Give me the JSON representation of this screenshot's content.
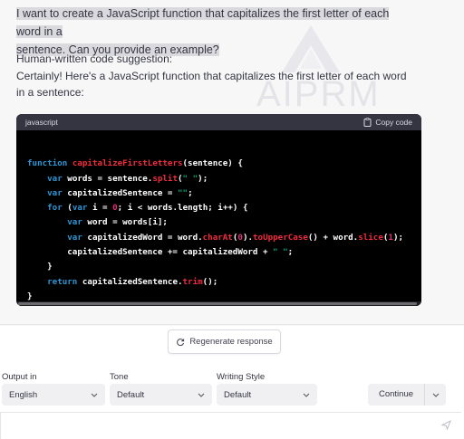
{
  "conversation": {
    "user_line_1": "I want to create a JavaScript function that capitalizes the first letter of each word in a",
    "user_line_2": "sentence. Can you provide an example?",
    "suggestion_label": "Human-written code suggestion:",
    "answer": "Certainly! Here's a JavaScript function that capitalizes the first letter of each word in a sentence:",
    "watermark": "AIPRM"
  },
  "code_block": {
    "language": "javascript",
    "copy_label": "Copy code",
    "lines": [
      "function capitalizeFirstLetters(sentence) {",
      "    var words = sentence.split(\" \");",
      "    var capitalizedSentence = \"\";",
      "    for (var i = 0; i < words.length; i++) {",
      "        var word = words[i];",
      "        var capitalizedWord = word.charAt(0).toUpperCase() + word.slice(1);",
      "        capitalizedSentence += capitalizedWord + \" \";",
      "    }",
      "    return capitalizedSentence.trim();",
      "}"
    ]
  },
  "controls": {
    "regenerate_label": "Regenerate response",
    "output_label": "Output in",
    "output_value": "English",
    "tone_label": "Tone",
    "tone_value": "Default",
    "style_label": "Writing Style",
    "style_value": "Default",
    "continue_label": "Continue",
    "input_placeholder": ""
  },
  "icons": {
    "copy": "clipboard-icon",
    "regenerate": "refresh-icon",
    "dropdown": "chevron-down-icon",
    "send": "paper-plane-icon"
  },
  "colors": {
    "keyword": "#2e95d3",
    "function": "#f22c3d",
    "string": "#00a67d",
    "number": "#df3079",
    "code_bg": "#000000",
    "code_header": "#343541"
  }
}
